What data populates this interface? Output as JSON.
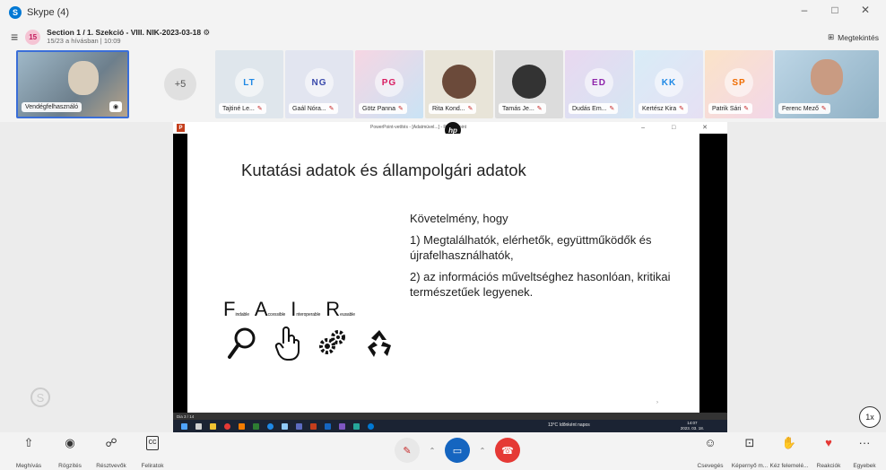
{
  "window": {
    "app_title": "Skype (4)",
    "minimize": "–",
    "maximize": "□",
    "close": "✕"
  },
  "header": {
    "badge": "15",
    "title": "Section 1 / 1. Szekció - VIII. NIK-2023-03-18 ⚙",
    "subtitle": "15/23 a hívásban | 10:09",
    "view_label": "Megtekintés"
  },
  "participants": {
    "self_name": "Vendégfelhasználó",
    "more_count": "+5",
    "tiles": [
      {
        "initials": "LT",
        "name": "Tajtiné Le...",
        "color": "#1e88e5"
      },
      {
        "initials": "NG",
        "name": "Gaál Nóra...",
        "color": "#3949ab"
      },
      {
        "initials": "PG",
        "name": "Götz Panna",
        "color": "#d81b60"
      },
      {
        "initials": "",
        "name": "Rita Kond...",
        "color": "#333333"
      },
      {
        "initials": "",
        "name": "Tamás Je...",
        "color": "#333333"
      },
      {
        "initials": "ED",
        "name": "Dudás Em...",
        "color": "#8e24aa"
      },
      {
        "initials": "KK",
        "name": "Kertész Kira",
        "color": "#1e88e5"
      },
      {
        "initials": "SP",
        "name": "Patrik Sári",
        "color": "#ef6c00"
      },
      {
        "initials": "",
        "name": "Ferenc Mező",
        "color": "#333333"
      }
    ]
  },
  "ppt": {
    "window_title": "PowerPoint-vetítés - [Adatmüvel...] - PowerPoint",
    "controls": "– □ ✕",
    "slide_title": "Kutatási adatok és állampolgári adatok",
    "body": [
      "Követelmény, hogy",
      "1) Megtalálhatók, elérhetők, együttműködők és újrafelhasználhatók,",
      "2) az információs műveltséghez hasonlóan, kritikai természetűek legyenek."
    ],
    "fair": [
      {
        "letter": "F",
        "rest": "indable"
      },
      {
        "letter": "A",
        "rest": "ccessible"
      },
      {
        "letter": "I",
        "rest": "nteroperable"
      },
      {
        "letter": "R",
        "rest": "eusable"
      }
    ],
    "status": "Dia 3 / 14",
    "weather": "13°C  Időnként napos",
    "clock_time": "14:07",
    "clock_date": "2023. 03. 18."
  },
  "controls": {
    "speed": "1x",
    "share_label": "Meghívás",
    "record_label": "Rögzítés",
    "participants_label": "Résztvevők",
    "captions_label": "Feliratok",
    "chat_label": "Csevegés",
    "screenshare_label": "Képernyő m...",
    "raise_hand_label": "Kéz felemelé...",
    "react_label": "Reakciók",
    "more_label": "Egyebek"
  }
}
